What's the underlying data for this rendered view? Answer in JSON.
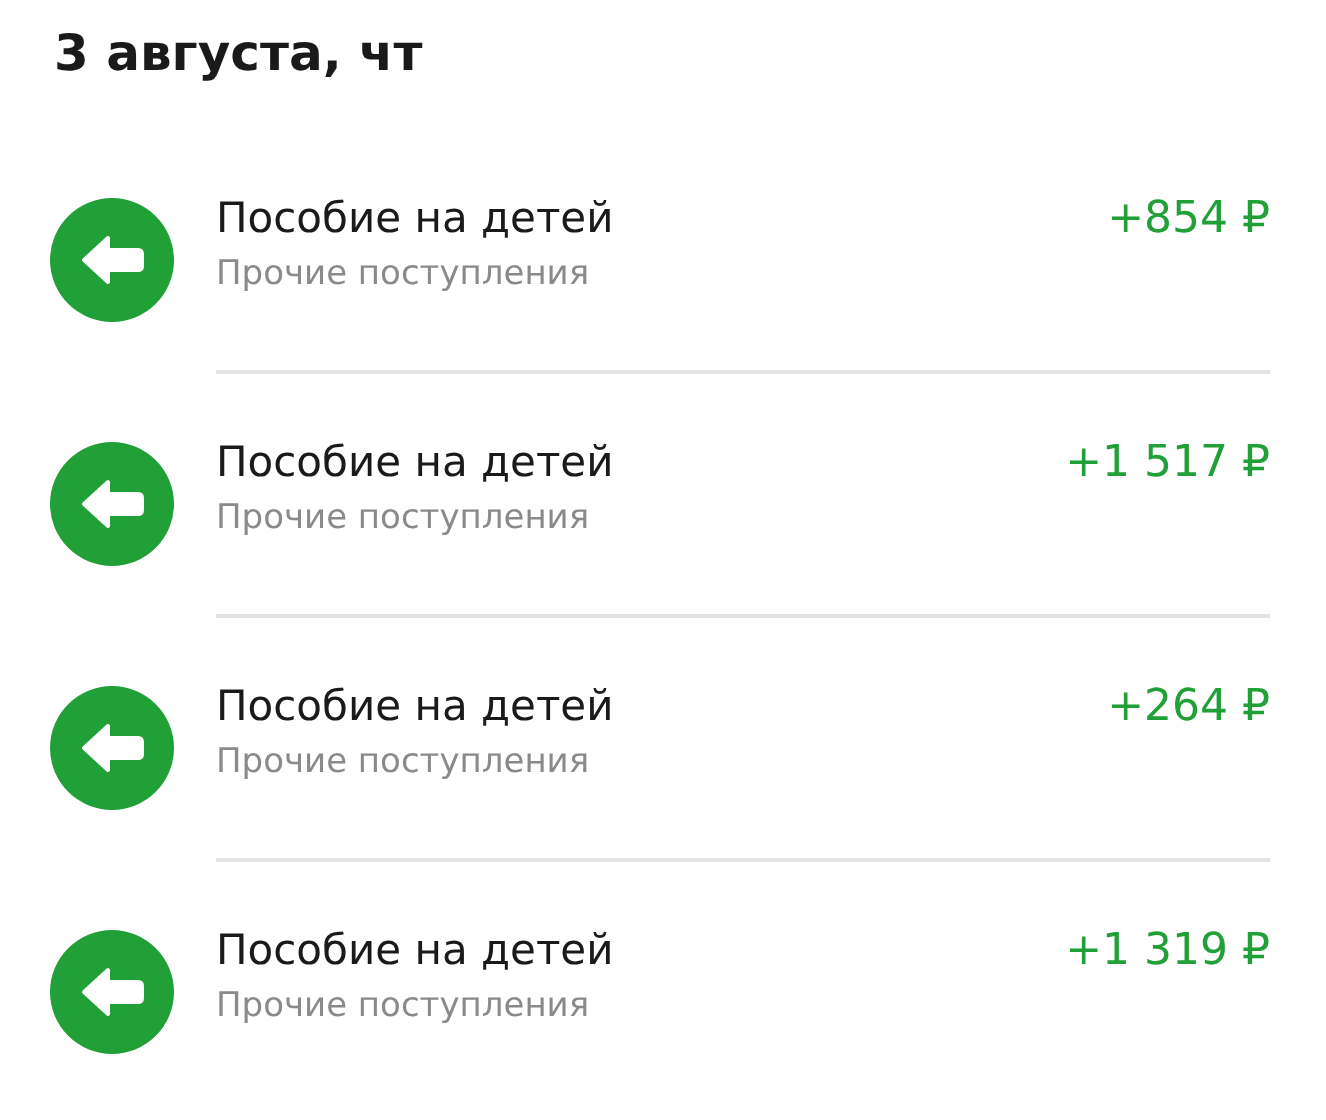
{
  "date_heading": "3 августа, чт",
  "transactions": [
    {
      "title": "Пособие на детей",
      "category": "Прочие поступления",
      "amount": "+854 ₽",
      "kind": "incoming"
    },
    {
      "title": "Пособие на детей",
      "category": "Прочие поступления",
      "amount": "+1 517 ₽",
      "kind": "incoming"
    },
    {
      "title": "Пособие на детей",
      "category": "Прочие поступления",
      "amount": "+264 ₽",
      "kind": "incoming"
    },
    {
      "title": "Пособие на детей",
      "category": "Прочие поступления",
      "amount": "+1 319 ₽",
      "kind": "incoming"
    }
  ]
}
